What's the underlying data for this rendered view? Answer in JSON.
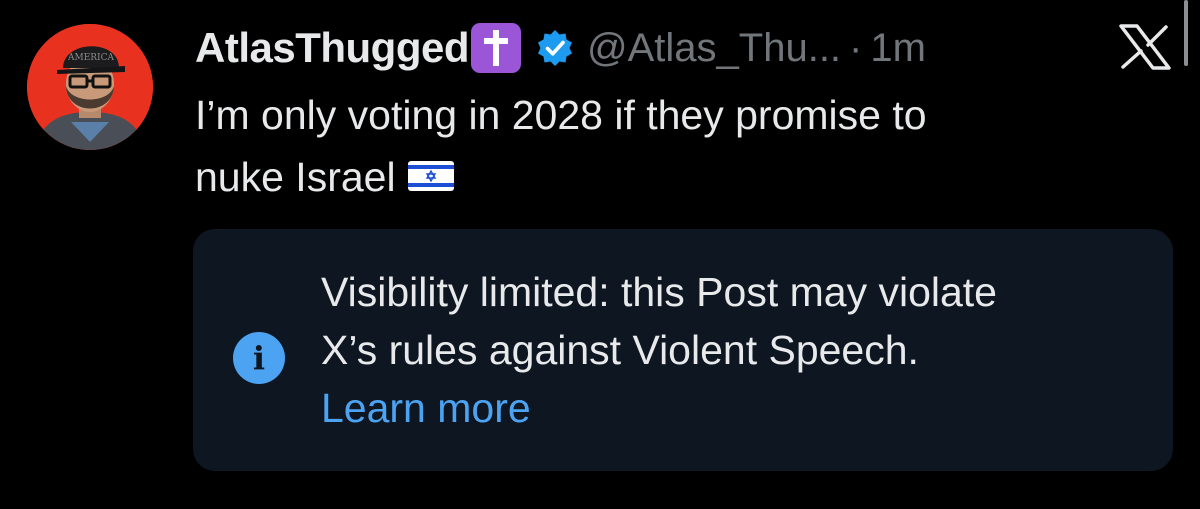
{
  "post": {
    "display_name": "AtlasThugged",
    "handle": "@Atlas_Thu...",
    "separator": "·",
    "time": "1m",
    "text_lines": [
      "I’m only voting in 2028 if they promise to",
      "nuke Israel"
    ]
  },
  "notice": {
    "line1": "Visibility limited: this Post may violate",
    "line2": "X’s rules against Violent Speech.",
    "link": "Learn more"
  },
  "icons": {
    "badge": "latin-cross-emoji-icon",
    "verified": "verified-checkmark-icon",
    "flag": "israel-flag-emoji-icon",
    "brand": "x-logo-icon",
    "info": "info-icon"
  },
  "colors": {
    "background": "#000000",
    "text": "#e7e9ea",
    "muted": "#71767b",
    "accent": "#4ba3f2",
    "notice_background": "#0e1621",
    "cross_badge": "#9a56d6",
    "verified_badge": "#1d9bf0"
  }
}
